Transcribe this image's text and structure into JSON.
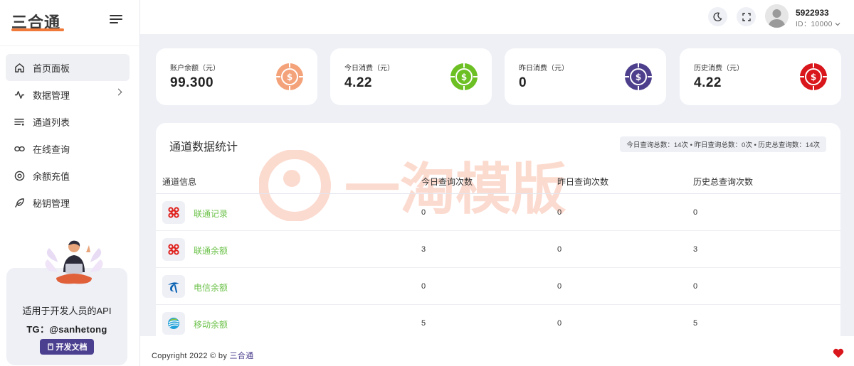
{
  "brand": {
    "logo_text": "三合通",
    "logo_accent": "#f07a3a"
  },
  "sidebar": {
    "items": [
      {
        "label": "首页面板",
        "icon": "home-icon",
        "active": true
      },
      {
        "label": "数据管理",
        "icon": "activity-icon",
        "has_submenu": true
      },
      {
        "label": "通道列表",
        "icon": "list-icon"
      },
      {
        "label": "在线查询",
        "icon": "link-icon"
      },
      {
        "label": "余额充值",
        "icon": "coin-icon"
      },
      {
        "label": "秘钥管理",
        "icon": "feather-icon"
      }
    ],
    "promo": {
      "title": "适用于开发人员的API",
      "tg": "TG：@sanhetong",
      "button_label": "开发文档",
      "button_icon": "book-icon"
    }
  },
  "header": {
    "user_name": "5922933",
    "user_id": "ID：10000",
    "icons": [
      "moon-icon",
      "fullscreen-icon",
      "avatar",
      "chevron-down-icon"
    ]
  },
  "stats": [
    {
      "label": "账户余额（元）",
      "value": "99.300",
      "color": "#f4a27a"
    },
    {
      "label": "今日消费（元）",
      "value": "4.22",
      "color": "#6cc024"
    },
    {
      "label": "昨日消费（元）",
      "value": "0",
      "color": "#4e3f8c"
    },
    {
      "label": "历史消费（元）",
      "value": "4.22",
      "color": "#d8161b"
    }
  ],
  "panel": {
    "title": "通道数据统计",
    "summary": "今日查询总数：14次 • 昨日查询总数：0次 • 历史总查询数：14次",
    "watermark": "一淘模版",
    "columns": [
      "通道信息",
      "今日查询次数",
      "昨日查询次数",
      "历史总查询次数"
    ],
    "rows": [
      {
        "name": "联通记录",
        "icon": "unicom-icon",
        "today": "0",
        "yesterday": "0",
        "total": "0"
      },
      {
        "name": "联通余额",
        "icon": "unicom-icon",
        "today": "3",
        "yesterday": "0",
        "total": "3"
      },
      {
        "name": "电信余额",
        "icon": "telecom-icon",
        "today": "0",
        "yesterday": "0",
        "total": "0"
      },
      {
        "name": "移动余额",
        "icon": "mobile-icon",
        "today": "5",
        "yesterday": "0",
        "total": "5"
      }
    ]
  },
  "footer": {
    "prefix": "Copyright 2022 © by ",
    "link": "三合通",
    "icon": "heart-icon",
    "heart_color": "#d8161b"
  }
}
